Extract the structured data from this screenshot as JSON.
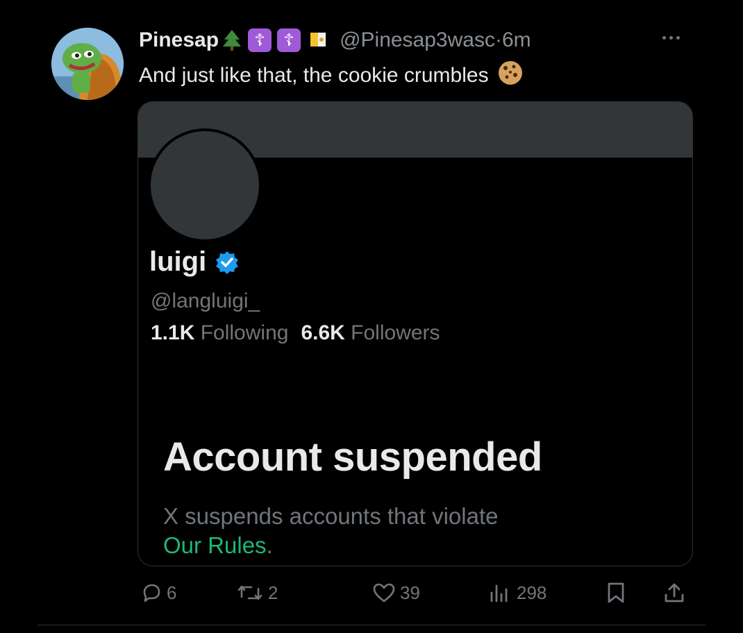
{
  "tweet": {
    "author_name": "Pinesap",
    "emojis": [
      "tree-emoji",
      "cross-emoji",
      "orthodox-cross-emoji",
      "vatican-flag-emoji"
    ],
    "cross_1": "☦",
    "cross_2": "☦",
    "handle": "@Pinesap3wasc",
    "separator": "·",
    "time": "6m",
    "text": "And just like that, the cookie crumbles"
  },
  "quoted_profile": {
    "name": "luigi",
    "handle": "@langluigi_",
    "following_count": "1.1K",
    "following_label": "Following",
    "followers_count": "6.6K",
    "followers_label": "Followers",
    "status_title": "Account suspended",
    "status_text": "X suspends accounts that violate",
    "rules_link": "Our Rules",
    "rules_period": "."
  },
  "actions": {
    "replies": "6",
    "reposts": "2",
    "likes": "39",
    "views": "298"
  },
  "colors": {
    "background": "#000000",
    "verified": "#1d9bf0",
    "link": "#1eb876",
    "muted": "#71767b",
    "cross_badge": "#a05ad8"
  }
}
